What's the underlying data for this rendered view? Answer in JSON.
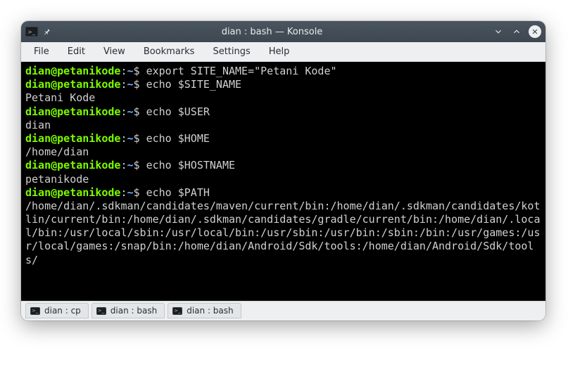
{
  "window": {
    "title": "dian : bash — Konsole"
  },
  "menu": {
    "file": "File",
    "edit": "Edit",
    "view": "View",
    "bookmarks": "Bookmarks",
    "settings": "Settings",
    "help": "Help"
  },
  "prompt": {
    "user_host": "dian@petanikode",
    "colon": ":",
    "path": "~",
    "dollar": "$"
  },
  "session": [
    {
      "type": "prompt",
      "cmd": "export SITE_NAME=\"Petani Kode\""
    },
    {
      "type": "prompt",
      "cmd": "echo $SITE_NAME"
    },
    {
      "type": "output",
      "text": "Petani Kode"
    },
    {
      "type": "prompt",
      "cmd": "echo $USER"
    },
    {
      "type": "output",
      "text": "dian"
    },
    {
      "type": "prompt",
      "cmd": "echo $HOME"
    },
    {
      "type": "output",
      "text": "/home/dian"
    },
    {
      "type": "prompt",
      "cmd": "echo $HOSTNAME"
    },
    {
      "type": "output",
      "text": "petanikode"
    },
    {
      "type": "prompt",
      "cmd": "echo $PATH"
    },
    {
      "type": "output",
      "wrap": true,
      "text": "/home/dian/.sdkman/candidates/maven/current/bin:/home/dian/.sdkman/candidates/kotlin/current/bin:/home/dian/.sdkman/candidates/gradle/current/bin:/home/dian/.local/bin:/usr/local/sbin:/usr/local/bin:/usr/sbin:/usr/bin:/sbin:/bin:/usr/games:/usr/local/games:/snap/bin:/home/dian/Android/Sdk/tools:/home/dian/Android/Sdk/tools/"
    }
  ],
  "tabs": [
    {
      "label": "dian : cp"
    },
    {
      "label": "dian : bash"
    },
    {
      "label": "dian : bash"
    }
  ]
}
